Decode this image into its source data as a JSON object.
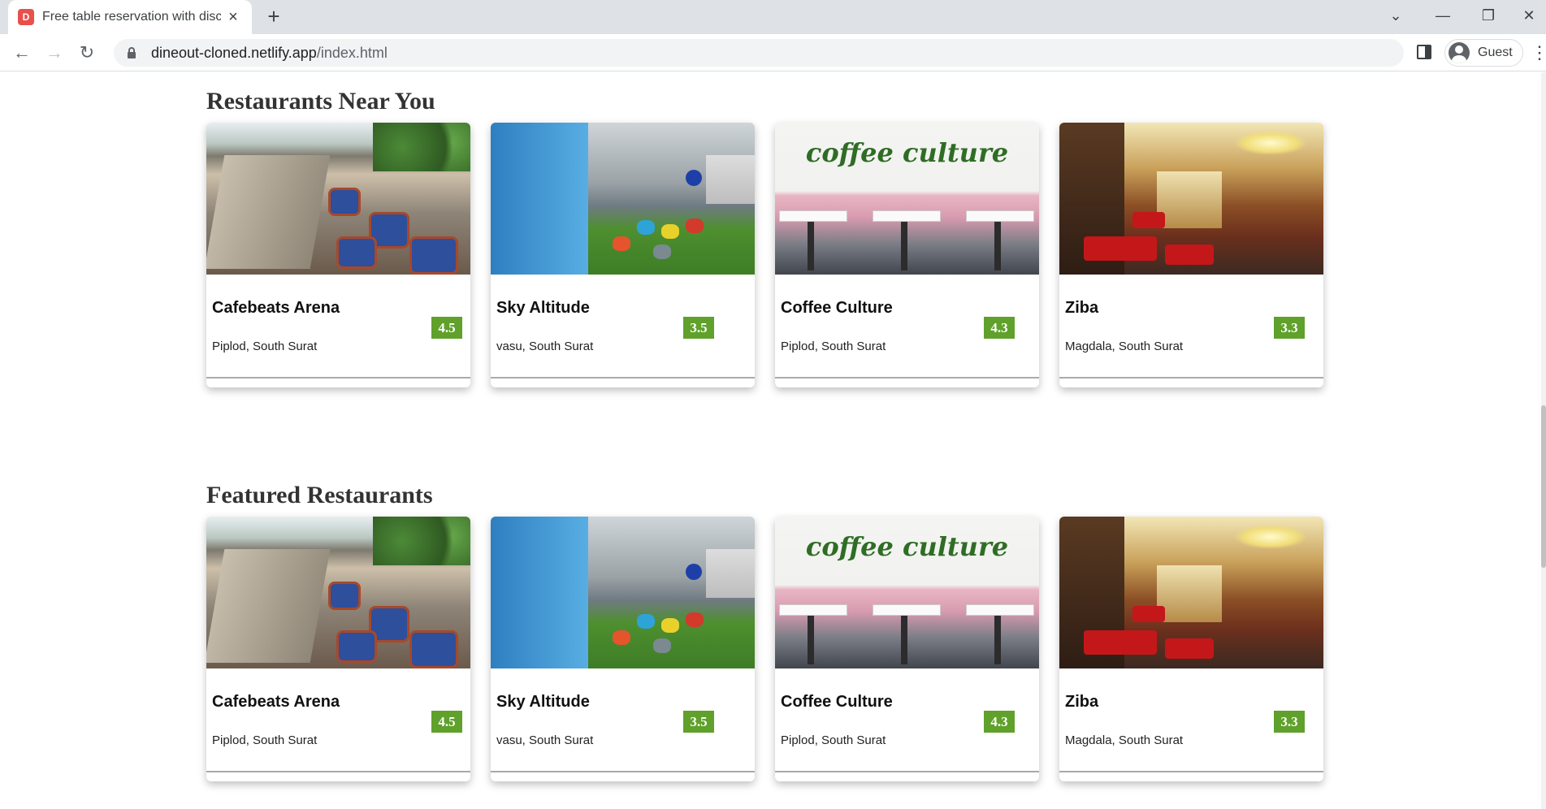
{
  "browser": {
    "tab_title": "Free table reservation with disco",
    "tab_favicon_glyph": "D",
    "new_tab_label": "+",
    "url_host": "dineout-cloned.netlify.app",
    "url_path": "/index.html",
    "profile_name": "Guest"
  },
  "sections": [
    {
      "title": "Restaurants Near You",
      "cards": [
        {
          "name": "Cafebeats Arena",
          "location": "Piplod, South Surat",
          "rating": "4.5"
        },
        {
          "name": "Sky Altitude",
          "location": "vasu, South Surat",
          "rating": "3.5"
        },
        {
          "name": "Coffee Culture",
          "location": "Piplod, South Surat",
          "rating": "4.3"
        },
        {
          "name": "Ziba",
          "location": "Magdala, South Surat",
          "rating": "3.3"
        }
      ]
    },
    {
      "title": "Featured Restaurants",
      "cards": [
        {
          "name": "Cafebeats Arena",
          "location": "Piplod, South Surat",
          "rating": "4.5"
        },
        {
          "name": "Sky Altitude",
          "location": "vasu, South Surat",
          "rating": "3.5"
        },
        {
          "name": "Coffee Culture",
          "location": "Piplod, South Surat",
          "rating": "4.3"
        },
        {
          "name": "Ziba",
          "location": "Magdala, South Surat",
          "rating": "3.3"
        }
      ]
    }
  ],
  "images": {
    "coffee_logo_text": "coffee culture"
  },
  "colors": {
    "rating_badge": "#5fa12b",
    "favicon": "#e8504b"
  }
}
